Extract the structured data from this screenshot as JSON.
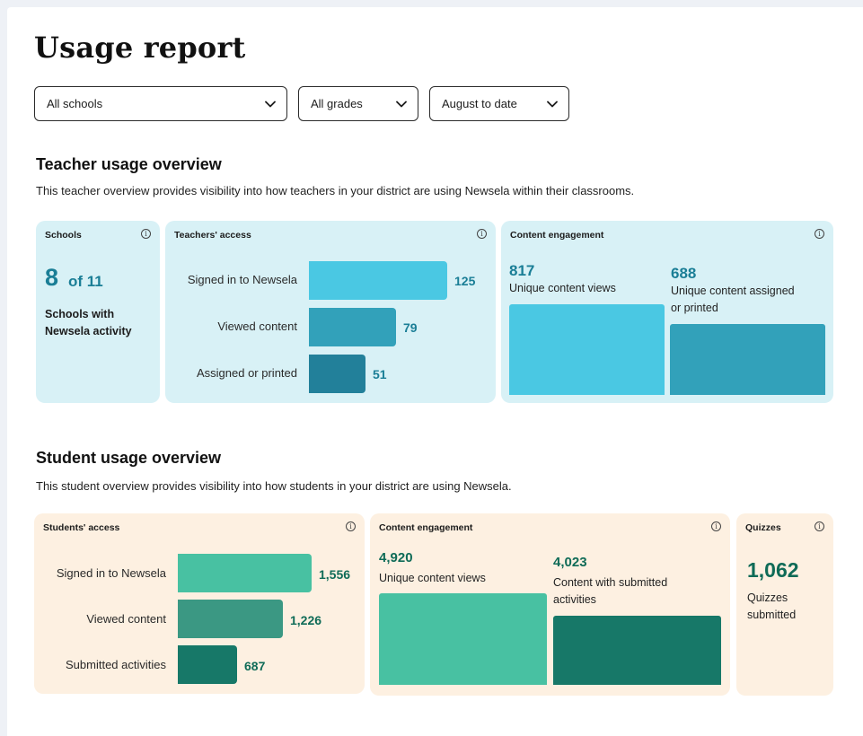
{
  "page": {
    "title": "Usage report"
  },
  "filters": {
    "school": "All schools",
    "grade": "All grades",
    "date": "August to date"
  },
  "teacher": {
    "title": "Teacher usage overview",
    "description": "This teacher overview provides visibility into how teachers in your district are using Newsela within their classrooms.",
    "schools": {
      "title": "Schools",
      "value": "8",
      "of_text": "of 11",
      "label_line1": "Schools with",
      "label_line2": "Newsela activity"
    },
    "access": {
      "title": "Teachers' access",
      "bars": [
        {
          "label": "Signed in to Newsela",
          "value": 125,
          "display": "125"
        },
        {
          "label": "Viewed content",
          "value": 79,
          "display": "79"
        },
        {
          "label": "Assigned or printed",
          "value": 51,
          "display": "51"
        }
      ]
    },
    "engagement": {
      "title": "Content engagement",
      "views": {
        "value": "817",
        "label": "Unique content views"
      },
      "assigned": {
        "value": "688",
        "label_line1": "Unique content assigned",
        "label_line2": "or printed"
      }
    }
  },
  "student": {
    "title": "Student usage overview",
    "description": "This student overview provides visibility into how students in your district are using Newsela.",
    "access": {
      "title": "Students' access",
      "bars": [
        {
          "label": "Signed in to Newsela",
          "value": 1556,
          "display": "1,556"
        },
        {
          "label": "Viewed content",
          "value": 1226,
          "display": "1,226"
        },
        {
          "label": "Submitted activities",
          "value": 687,
          "display": "687"
        }
      ]
    },
    "engagement": {
      "title": "Content engagement",
      "views": {
        "value": "4,920",
        "label": "Unique content views"
      },
      "submitted": {
        "value": "4,023",
        "label_line1": "Content with submitted",
        "label_line2": "activities"
      }
    },
    "quizzes": {
      "title": "Quizzes",
      "value": "1,062",
      "label_line1": "Quizzes",
      "label_line2": "submitted"
    }
  },
  "colors": {
    "teal_light": "#4ac8e3",
    "teal_mid": "#32a1ba",
    "teal_dark": "#22809a",
    "teal_text": "#1a7e96",
    "green_light": "#48c1a2",
    "green_mid": "#3b9883",
    "green_dark": "#177868",
    "green_text": "#0f6b57"
  }
}
